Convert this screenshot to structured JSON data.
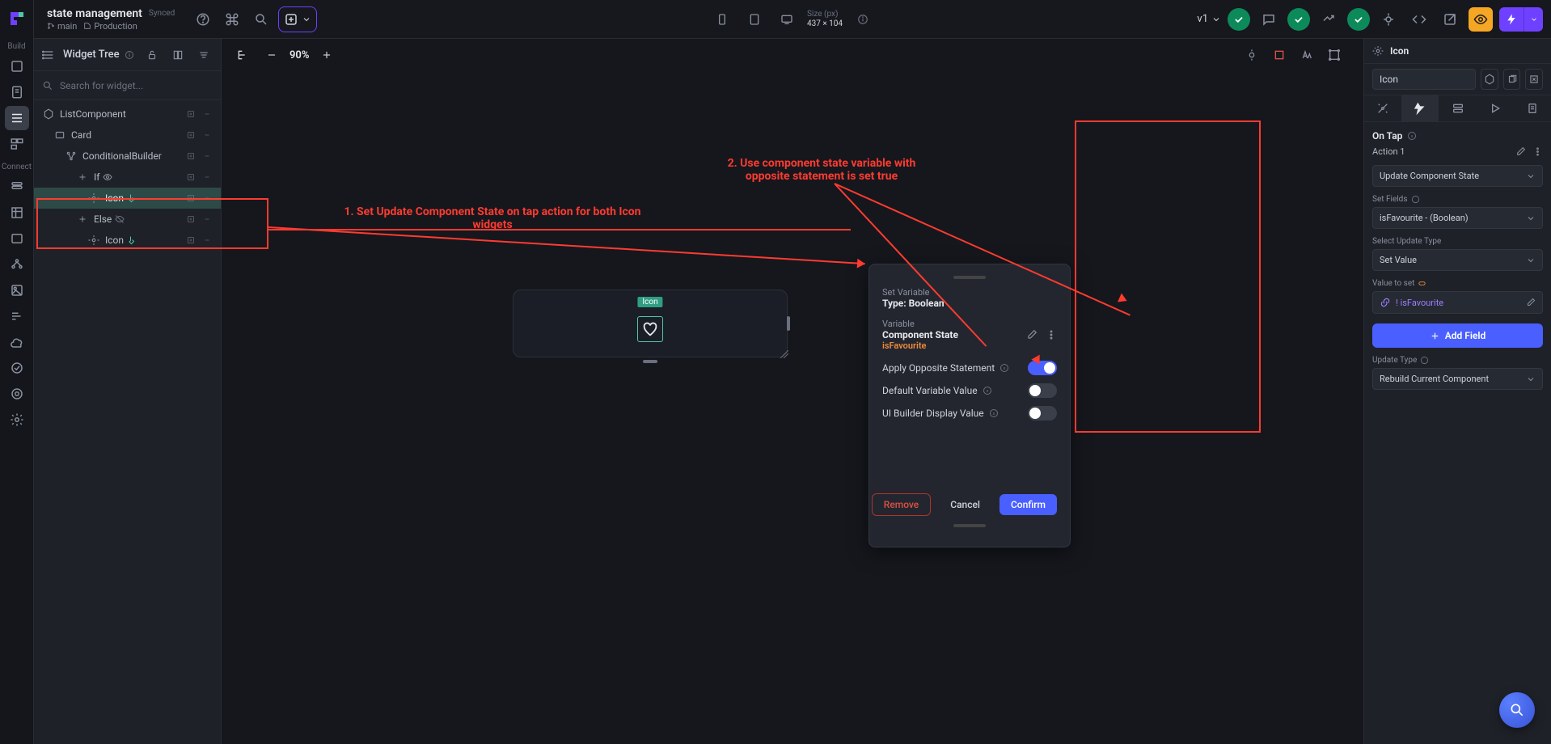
{
  "project": {
    "title": "state management",
    "synced": "Synced",
    "branch": "main",
    "environment": "Production"
  },
  "topbar": {
    "size_label": "Size (px)",
    "size_value": "437 × 104",
    "version": "v1"
  },
  "tree": {
    "header": "Widget Tree",
    "search_placeholder": "Search for widget...",
    "items": [
      {
        "label": "ListComponent",
        "indent": 0,
        "kind": "component"
      },
      {
        "label": "Card",
        "indent": 1,
        "kind": "card"
      },
      {
        "label": "ConditionalBuilder",
        "indent": 2,
        "kind": "conditional"
      },
      {
        "label": "If",
        "indent": 3,
        "kind": "if",
        "visible": true
      },
      {
        "label": "Icon",
        "indent": 4,
        "kind": "icon",
        "selected": true,
        "tapAction": true
      },
      {
        "label": "Else",
        "indent": 3,
        "kind": "else",
        "hidden": true
      },
      {
        "label": "Icon",
        "indent": 4,
        "kind": "icon",
        "tapAction": true
      }
    ]
  },
  "canvas": {
    "zoom": "90%",
    "icon_tag": "Icon"
  },
  "annotations": {
    "a1_line1": "1. Set Update Component State on tap action for both Icon",
    "a1_line2": "widgets",
    "a2_line1": "2. Use component state variable with",
    "a2_line2": "opposite statement is set true"
  },
  "varPopup": {
    "setvar_label": "Set Variable",
    "type_label": "Type: Boolean",
    "variable_label": "Variable",
    "variable_scope": "Component State",
    "variable_name": "isFavourite",
    "apply_opposite": "Apply Opposite Statement",
    "default_value": "Default Variable Value",
    "ui_builder": "UI Builder Display Value",
    "remove": "Remove",
    "cancel": "Cancel",
    "confirm": "Confirm"
  },
  "rightPanel": {
    "head_title": "Icon",
    "name_value": "Icon",
    "trigger": "On Tap",
    "action_label": "Action 1",
    "action_type": "Update Component State",
    "set_fields_label": "Set Fields",
    "field_value": "isFavourite - (Boolean)",
    "update_type_label": "Select Update Type",
    "update_type_value": "Set Value",
    "value_to_set_label": "Value to set",
    "value_expr": "! isFavourite",
    "add_field": "Add Field",
    "update_type2_label": "Update Type",
    "update_type2_value": "Rebuild Current Component"
  },
  "rail": {
    "build": "Build",
    "connect": "Connect"
  }
}
